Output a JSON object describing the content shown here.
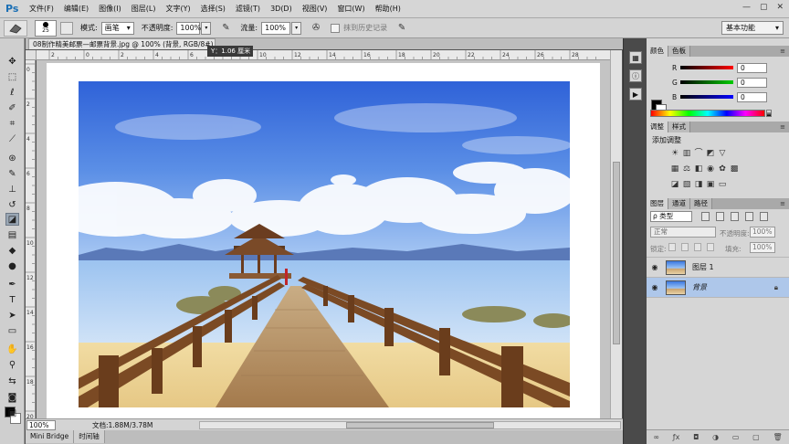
{
  "app": {
    "logo": "Ps",
    "menu": [
      "文件(F)",
      "编辑(E)",
      "图像(I)",
      "图层(L)",
      "文字(Y)",
      "选择(S)",
      "滤镜(T)",
      "3D(D)",
      "视图(V)",
      "窗口(W)",
      "帮助(H)"
    ],
    "window_buttons": [
      "—",
      "▢",
      "✕"
    ]
  },
  "options": {
    "brush_size": "25",
    "mode_label": "模式:",
    "mode_value": "画笔",
    "opacity_label": "不透明度:",
    "opacity_value": "100%",
    "flow_label": "流量:",
    "flow_value": "100%",
    "erase_history_label": "抹到历史记录",
    "workspace": "基本功能"
  },
  "document": {
    "tab_title": "08制作精美邮票—邮票背景.jpg @ 100% (背景, RGB/8#)",
    "tab_modified": "*",
    "tab_close": "×",
    "tooltip": "Y：1.06 厘米",
    "ruler_h_labels": [
      "2",
      "0",
      "2",
      "4",
      "6",
      "8",
      "10",
      "12",
      "14",
      "16",
      "18",
      "20",
      "22",
      "24",
      "26",
      "28"
    ],
    "ruler_v_labels": [
      "0",
      "2",
      "4",
      "6",
      "8",
      "10",
      "12",
      "14",
      "16",
      "18",
      "20"
    ],
    "zoom": "100%",
    "doc_size": "文档:1.88M/3.78M",
    "bottom_tabs": [
      "Mini Bridge",
      "时间轴"
    ]
  },
  "colors_panel": {
    "tabs": [
      "颜色",
      "色板"
    ],
    "r_label": "R",
    "r_value": "0",
    "g_label": "G",
    "g_value": "0",
    "b_label": "B",
    "b_value": "0"
  },
  "adjustments_panel": {
    "tabs": [
      "调整",
      "样式"
    ],
    "title": "添加调整"
  },
  "layers_panel": {
    "tabs": [
      "图层",
      "通道",
      "路径"
    ],
    "filter": "ρ 类型",
    "blend_mode": "正常",
    "opacity_label": "不透明度:",
    "opacity_value": "100%",
    "lock_label": "锁定:",
    "fill_label": "填充:",
    "fill_value": "100%",
    "layers": [
      {
        "name": "图层 1",
        "selected": false,
        "locked": false
      },
      {
        "name": "背景",
        "selected": true,
        "locked": true
      }
    ]
  },
  "theme": {
    "accent": "#1a6fb5",
    "selected_layer": "#aec7ea"
  }
}
